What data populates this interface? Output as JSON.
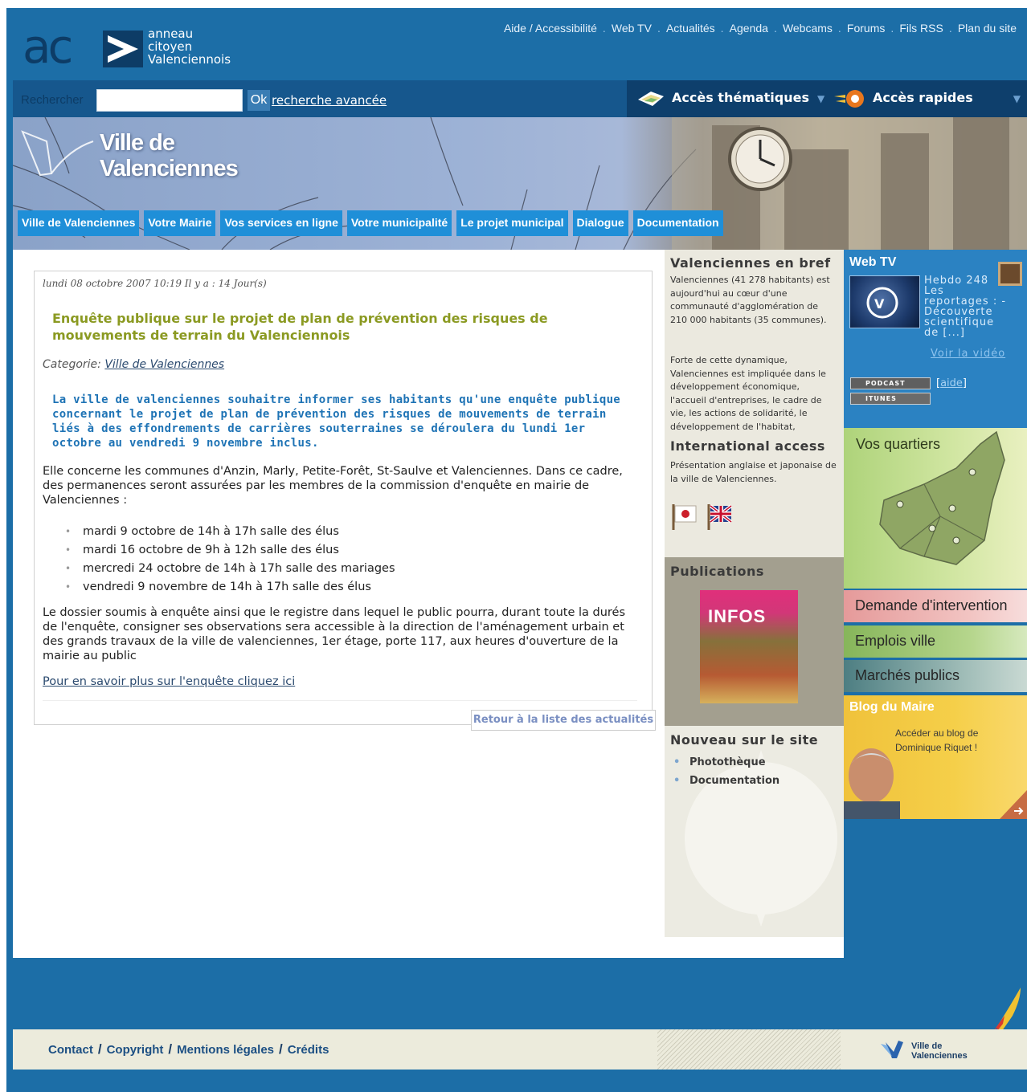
{
  "header": {
    "logo": {
      "letters": "ac",
      "line1": "anneau",
      "line2": "citoyen",
      "line3": "Valenciennois"
    },
    "top_links": [
      "Aide / Accessibilité",
      "Web TV",
      "Actualités",
      "Agenda",
      "Webcams",
      "Forums",
      "Fils RSS",
      "Plan du site"
    ],
    "search": {
      "label": "Rechercher",
      "value": "",
      "ok": "Ok",
      "advanced": "recherche avancée"
    },
    "access": {
      "thematic": "Accès thématiques",
      "quick": "Accès rapides"
    }
  },
  "banner": {
    "title_line1": "Ville de",
    "title_line2": "Valenciennes",
    "nav": [
      "Ville de Valenciennes",
      "Votre Mairie",
      "Vos services en ligne",
      "Votre municipalité",
      "Le projet municipal",
      "Dialogue",
      "Documentation"
    ]
  },
  "article": {
    "date": "lundi 08 octobre 2007 10:19 Il y a : 14 Jour(s)",
    "title": "Enquête publique sur le projet de plan de prévention des risques de mouvements de terrain du Valenciennois",
    "category_label": "Categorie:",
    "category_link": "Ville de Valenciennes",
    "intro": "La ville de valenciennes souhaitre informer ses habitants qu'une enquête publique concernant le projet de plan de prévention des risques de mouvements de terrain liés à des effondrements de carrières souterraines se déroulera du lundi 1er octobre au vendredi 9 novembre inclus.",
    "body1": "Elle concerne les communes d'Anzin, Marly, Petite-Forêt, St-Saulve et Valenciennes. Dans ce cadre, des permanences seront assurées par les membres de la commission d'enquête en mairie de Valenciennes :",
    "permanences": [
      "mardi 9 octobre de 14h à 17h salle des élus",
      "mardi 16 octobre de 9h à 12h salle des élus",
      "mercredi 24 octobre de 14h à 17h salle des mariages",
      "vendredi 9 novembre de 14h à 17h salle des élus"
    ],
    "body2": "Le dossier soumis à enquête ainsi que le registre dans lequel le public pourra, durant toute la durés de l'enquête, consigner ses observations sera accessible à la direction de l'aménagement urbain et des grands travaux de la ville de valenciennes, 1er étage, porte 117, aux heures d'ouverture de la mairie au public",
    "more_link": "Pour en savoir plus sur l'enquête cliquez ici",
    "back_link": "Retour à la liste des actualités"
  },
  "middle": {
    "bref_title": "Valenciennes en bref",
    "bref_text1": "Valenciennes (41 278 habitants) est aujourd'hui au cœur d'une communauté d'agglomération de 210 000 habitants (35 communes).",
    "bref_text2": "Forte de cette dynamique, Valenciennes est impliquée dans le développement économique, l'accueil d'entreprises, le cadre de vie, les actions de solidarité, le développement de l'habitat,",
    "intl_title": "International access",
    "intl_text": "Présentation anglaise et japonaise de la ville de Valenciennes.",
    "pub_title": "Publications",
    "pub_cover_title": "INFOS",
    "new_title": "Nouveau sur le site",
    "new_items": [
      "Photothèque",
      "Documentation"
    ]
  },
  "right": {
    "webtv_title": "Web TV",
    "webtv_text": "Hebdo 248 Les reportages : - Découverte scientifique de [...]",
    "webtv_link": "Voir la vidéo",
    "podcast": "PODCAST",
    "itunes": "ITUNES",
    "help": "aide",
    "quartiers": "Vos quartiers",
    "demande": "Demande d'intervention",
    "emplois": "Emplois ville",
    "marches": "Marchés publics",
    "blog_title": "Blog du Maire",
    "blog_text": "Accéder au blog de Dominique Riquet !"
  },
  "footer": {
    "links": [
      "Contact",
      "Copyright",
      "Mentions légales",
      "Crédits"
    ],
    "logo_line1": "Ville de",
    "logo_line2": "Valenciennes"
  },
  "colors": {
    "page_blue": "#1c6ea7",
    "nav_blue": "#1f8fd8",
    "title_olive": "#8b9a22",
    "intro_blue": "#1e73b5"
  }
}
